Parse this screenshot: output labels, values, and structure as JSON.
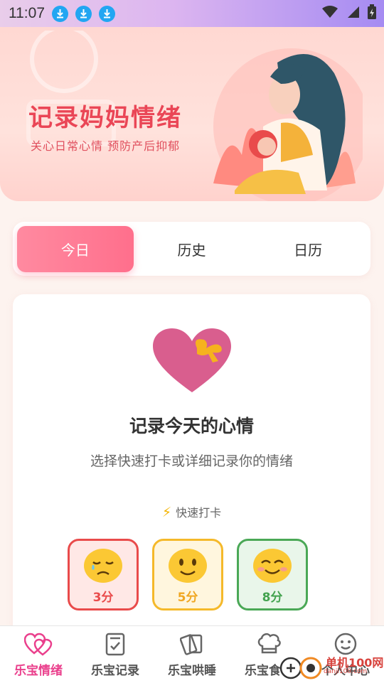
{
  "status_bar": {
    "time": "11:07",
    "icons": [
      "download-icon",
      "download-icon",
      "download-icon",
      "wifi-icon",
      "signal-icon",
      "battery-charging-icon"
    ]
  },
  "banner": {
    "title": "记录妈妈情绪",
    "subtitle": "关心日常心情 预防产后抑郁"
  },
  "tabs": [
    {
      "label": "今日",
      "active": true
    },
    {
      "label": "历史",
      "active": false
    },
    {
      "label": "日历",
      "active": false
    }
  ],
  "today_card": {
    "title": "记录今天的心情",
    "subtitle": "选择快速打卡或详细记录你的情绪",
    "quick_checkin_label": "快速打卡",
    "moods": [
      {
        "score": "3分",
        "icon": "sad-face-icon",
        "color": "#e94b4b"
      },
      {
        "score": "5分",
        "icon": "smile-face-icon",
        "color": "#f5b92a"
      },
      {
        "score": "8分",
        "icon": "happy-face-icon",
        "color": "#4aa856"
      }
    ]
  },
  "bottom_nav": [
    {
      "label": "乐宝情绪",
      "icon": "hearts-icon",
      "active": true
    },
    {
      "label": "乐宝记录",
      "icon": "checklist-icon",
      "active": false
    },
    {
      "label": "乐宝哄睡",
      "icon": "cards-icon",
      "active": false
    },
    {
      "label": "乐宝食物",
      "icon": "chef-hat-icon",
      "active": false
    },
    {
      "label": "个人中心",
      "icon": "smiley-icon",
      "active": false
    }
  ],
  "watermark": {
    "text": "单机100网",
    "url": "danji100.com"
  },
  "colors": {
    "accent": "#ff6f8c",
    "nav_active": "#ea3f8c",
    "banner_title": "#ea4656"
  }
}
